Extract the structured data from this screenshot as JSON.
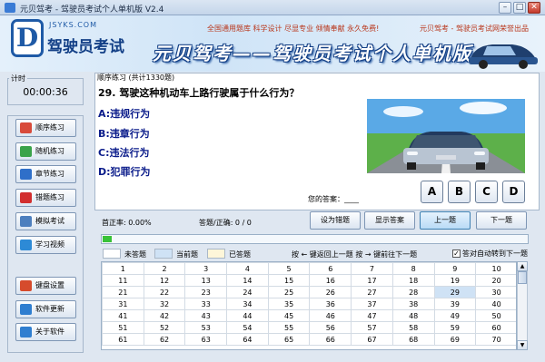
{
  "window": {
    "title": "元贝驾考 - 驾驶员考试个人单机版 V2.4",
    "minimize": "–",
    "maximize": "□",
    "close": "✕"
  },
  "banner": {
    "logo_letter": "D",
    "logo_site": "JSYKS.COM",
    "logo_text": "驾驶员考试",
    "links": "全国通用题库  科学设计  尽显专业  倾情奉献  永久免费!",
    "brand": "元贝驾考 - 驾驶员考试网荣誉出品",
    "slogan": "元贝驾考——驾驶员考试个人单机版"
  },
  "timer": {
    "label": "计时",
    "value": "00:00:36"
  },
  "nav": [
    {
      "label": "顺序练习",
      "icon": "pencil-icon",
      "color": "#d84a3a"
    },
    {
      "label": "随机练习",
      "icon": "shuffle-icon",
      "color": "#3aa34a"
    },
    {
      "label": "章节练习",
      "icon": "book-icon",
      "color": "#2f6fc9"
    },
    {
      "label": "错题练习",
      "icon": "flag-icon",
      "color": "#d22e2e"
    },
    {
      "label": "模拟考试",
      "icon": "form-icon",
      "color": "#4d7fbe"
    },
    {
      "label": "学习视频",
      "icon": "video-icon",
      "color": "#2d8ad6"
    },
    {
      "label": "键盘设置",
      "icon": "keyboard-icon",
      "color": "#d64b2c"
    },
    {
      "label": "软件更新",
      "icon": "update-icon",
      "color": "#2f7ed0"
    },
    {
      "label": "关于软件",
      "icon": "info-icon",
      "color": "#2f7ed0"
    }
  ],
  "question": {
    "header": "顺序练习 (共计1330题)",
    "text": "29. 驾驶这种机动车上路行驶属于什么行为？",
    "options": [
      "A:违规行为",
      "B:违章行为",
      "C:违法行为",
      "D:犯罪行为"
    ],
    "answer_prompt": "您的答案：____",
    "answer_buttons": [
      "A",
      "B",
      "C",
      "D"
    ]
  },
  "stats": {
    "accuracy": "首正率: 0.00%",
    "answered": "答题/正确: 0 / 0",
    "progress": 0.02
  },
  "actions": {
    "set_wrong": "设为错题",
    "show_answer": "显示答案",
    "prev": "上一题",
    "next": "下一题"
  },
  "legend": {
    "unanswered": "未答题",
    "current": "当前题",
    "answered": "已答题",
    "unanswered_color": "#ffffff",
    "current_color": "#cfe2f5",
    "answered_color": "#fdf6d9"
  },
  "key_hint": "按 ← 键返回上一题   按 → 键前往下一题",
  "auto_next": {
    "label": "答对自动转到下一题",
    "checked": "✓"
  },
  "grid": {
    "current": 29,
    "rows": [
      [
        "1",
        "2",
        "3",
        "4",
        "5",
        "6",
        "7",
        "8",
        "9",
        "10"
      ],
      [
        "11",
        "12",
        "13",
        "14",
        "15",
        "16",
        "17",
        "18",
        "19",
        "20"
      ],
      [
        "21",
        "22",
        "23",
        "24",
        "25",
        "26",
        "27",
        "28",
        "29",
        "30"
      ],
      [
        "31",
        "32",
        "33",
        "34",
        "35",
        "36",
        "37",
        "38",
        "39",
        "40"
      ],
      [
        "41",
        "42",
        "43",
        "44",
        "45",
        "46",
        "47",
        "48",
        "49",
        "50"
      ],
      [
        "51",
        "52",
        "53",
        "54",
        "55",
        "56",
        "57",
        "58",
        "59",
        "60"
      ],
      [
        "61",
        "62",
        "63",
        "64",
        "65",
        "66",
        "67",
        "68",
        "69",
        "70"
      ]
    ]
  },
  "scroll": {
    "up": "▲",
    "down": "▼"
  }
}
